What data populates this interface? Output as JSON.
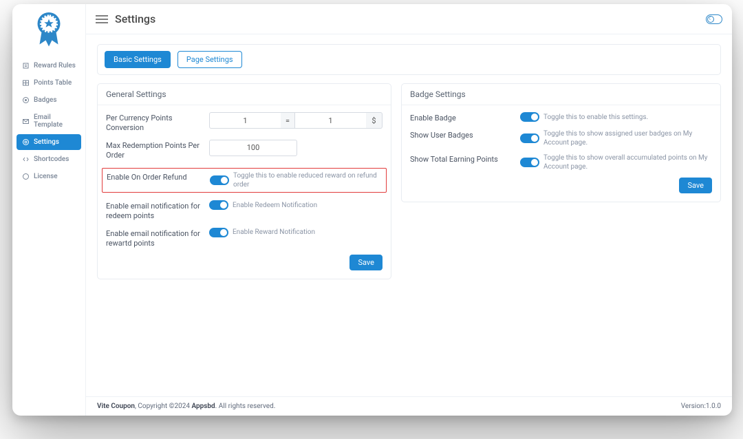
{
  "header": {
    "title": "Settings"
  },
  "sidebar": {
    "items": [
      {
        "label": "Reward Rules"
      },
      {
        "label": "Points Table"
      },
      {
        "label": "Badges"
      },
      {
        "label": "Email Template"
      },
      {
        "label": "Settings"
      },
      {
        "label": "Shortcodes"
      },
      {
        "label": "License"
      }
    ]
  },
  "tabs": {
    "basic": "Basic Settings",
    "page": "Page Settings"
  },
  "general": {
    "title": "General Settings",
    "per_currency_label": "Per Currency Points Conversion",
    "per_currency_left": "1",
    "per_currency_eq": "=",
    "per_currency_right": "1",
    "per_currency_symbol": "$",
    "max_redemption_label": "Max Redemption Points Per Order",
    "max_redemption_value": "100",
    "refund_label": "Enable On Order Refund",
    "refund_desc": "Toggle this to enable reduced reward on refund order",
    "redeem_label": "Enable email notification for redeem points",
    "redeem_desc": "Enable Redeem Notification",
    "reward_label": "Enable email notification for rewartd points",
    "reward_desc": "Enable Reward Notification",
    "save": "Save"
  },
  "badge": {
    "title": "Badge Settings",
    "enable_label": "Enable Badge",
    "enable_desc": "Toggle this to enable this settings.",
    "show_user_label": "Show User Badges",
    "show_user_desc": "Toggle this to show assigned user badges on My Account page.",
    "show_total_label": "Show Total Earning Points",
    "show_total_desc": "Toggle this to show overall accumulated points on My Account page.",
    "save": "Save"
  },
  "footer": {
    "brand": "Vite Coupon",
    "copyright": ", Copyright ©2024 ",
    "company": "Appsbd",
    "rights": ". All rights reserved.",
    "version": "Version:1.0.0"
  }
}
